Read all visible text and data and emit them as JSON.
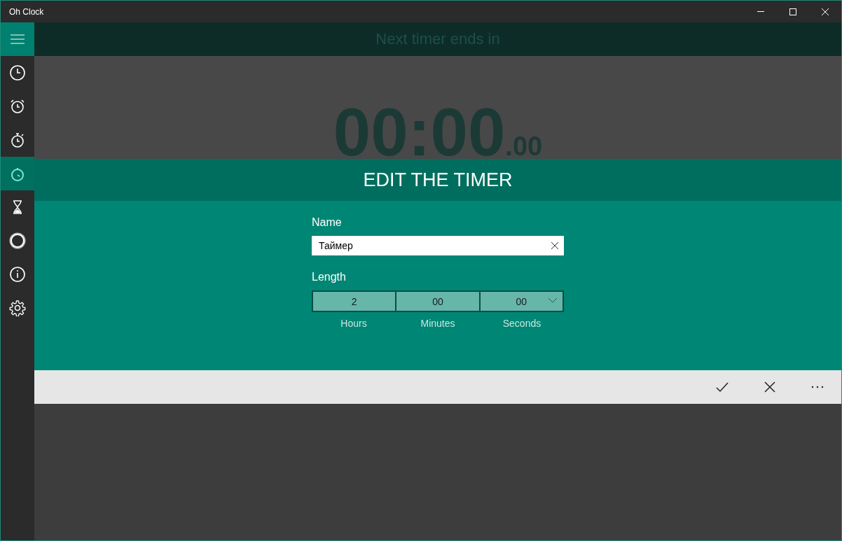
{
  "window": {
    "title": "Oh Clock"
  },
  "sidebar": {
    "items": [
      {
        "kind": "clock",
        "selected": false
      },
      {
        "kind": "alarm",
        "selected": false
      },
      {
        "kind": "stopwatch",
        "selected": false
      },
      {
        "kind": "timer",
        "selected": true
      },
      {
        "kind": "hourglass",
        "selected": false
      },
      {
        "kind": "ring",
        "selected": false
      },
      {
        "kind": "info",
        "selected": false
      },
      {
        "kind": "settings",
        "selected": false
      }
    ]
  },
  "header": {
    "title": "Next timer ends in"
  },
  "countdown": {
    "main": "00:00",
    "fraction": ".00"
  },
  "dialog": {
    "title": "EDIT THE TIMER",
    "name_label": "Name",
    "name_value": "Таймер",
    "length_label": "Length",
    "fields": [
      {
        "value": "2",
        "label": "Hours"
      },
      {
        "value": "00",
        "label": "Minutes"
      },
      {
        "value": "00",
        "label": "Seconds",
        "dropdown": true
      }
    ]
  },
  "command_bar": {
    "actions": [
      {
        "kind": "accept"
      },
      {
        "kind": "cancel"
      },
      {
        "kind": "more"
      }
    ]
  }
}
